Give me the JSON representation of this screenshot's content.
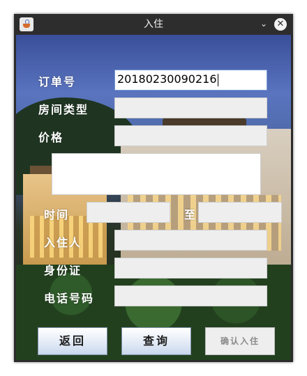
{
  "window": {
    "title": "入住"
  },
  "icons": {
    "app": "java-cup-icon",
    "minimize": "chevron-down-icon",
    "close": "close-icon"
  },
  "form": {
    "order_no": {
      "label": "订单号",
      "value": "20180230090216"
    },
    "room_type": {
      "label": "房间类型",
      "value": ""
    },
    "price": {
      "label": "价格",
      "value": ""
    },
    "notes": {
      "value": ""
    },
    "time": {
      "label": "时间",
      "from": "",
      "separator": "至",
      "to": ""
    },
    "guest": {
      "label": "入住人",
      "value": ""
    },
    "id_card": {
      "label": "身份证",
      "value": ""
    },
    "phone": {
      "label": "电话号码",
      "value": ""
    }
  },
  "buttons": {
    "back": "返回",
    "query": "查询",
    "confirm": "确认入住"
  },
  "colors": {
    "accent": "#7a9cd3",
    "button_gradient_end": "#c9d8ee",
    "disabled_text": "#8a8a8a"
  }
}
